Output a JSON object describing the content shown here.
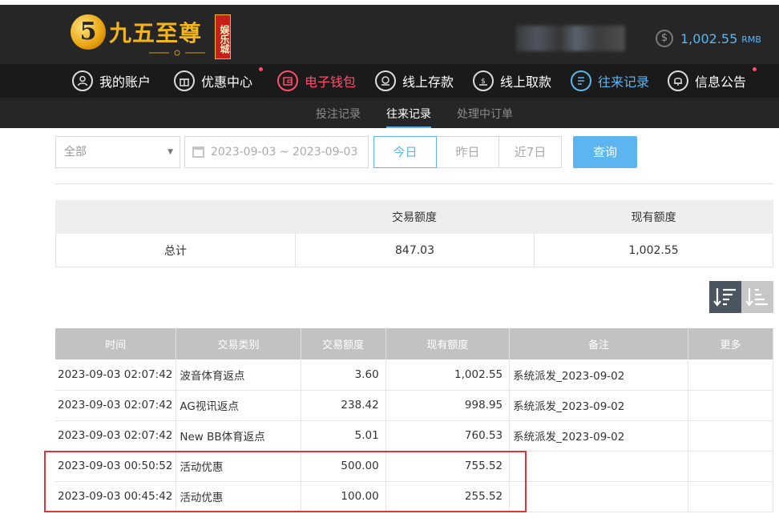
{
  "brand": {
    "logo_number": "5",
    "name": "九五至尊",
    "badge": "娱乐城"
  },
  "account": {
    "balance": "1,002.55",
    "currency": "RMB",
    "currency_icon": "dollar-coin-icon"
  },
  "nav": {
    "items": [
      {
        "label": "我的账户",
        "icon": "user-icon"
      },
      {
        "label": "优惠中心",
        "icon": "gift-icon"
      },
      {
        "label": "电子钱包",
        "icon": "wallet-icon"
      },
      {
        "label": "线上存款",
        "icon": "deposit-icon"
      },
      {
        "label": "线上取款",
        "icon": "withdraw-icon"
      },
      {
        "label": "往来记录",
        "icon": "records-icon"
      },
      {
        "label": "信息公告",
        "icon": "bell-icon"
      }
    ]
  },
  "subnav": {
    "tabs": [
      "投注记录",
      "往来记录",
      "处理中订单"
    ],
    "active": "往来记录"
  },
  "filters": {
    "type_select": "全部",
    "date_range": "2023-09-03 ~ 2023-09-03",
    "quick_ranges": [
      "今日",
      "昨日",
      "近7日"
    ],
    "active_range": "今日",
    "query_label": "查询"
  },
  "summary": {
    "headers": [
      "",
      "交易额度",
      "现有额度"
    ],
    "row": [
      "总计",
      "847.03",
      "1,002.55"
    ]
  },
  "table": {
    "headers": [
      "时间",
      "交易类别",
      "交易额度",
      "现有额度",
      "备注",
      "更多"
    ],
    "rows": [
      [
        "2023-09-03 02:07:42",
        "波音体育返点",
        "3.60",
        "1,002.55",
        "系统派发_2023-09-02",
        ""
      ],
      [
        "2023-09-03 02:07:42",
        "AG视讯返点",
        "238.42",
        "998.95",
        "系统派发_2023-09-02",
        ""
      ],
      [
        "2023-09-03 02:07:42",
        "New BB体育返点",
        "5.01",
        "760.53",
        "系统派发_2023-09-02",
        ""
      ],
      [
        "2023-09-03 00:50:52",
        "活动优惠",
        "500.00",
        "755.52",
        "",
        ""
      ],
      [
        "2023-09-03 00:45:42",
        "活动优惠",
        "100.00",
        "255.52",
        "",
        ""
      ]
    ]
  },
  "colors": {
    "accent_blue": "#5db5f0",
    "accent_red": "#ff4d6d",
    "highlight_red": "#e0353b",
    "header_bg": "#262626"
  }
}
